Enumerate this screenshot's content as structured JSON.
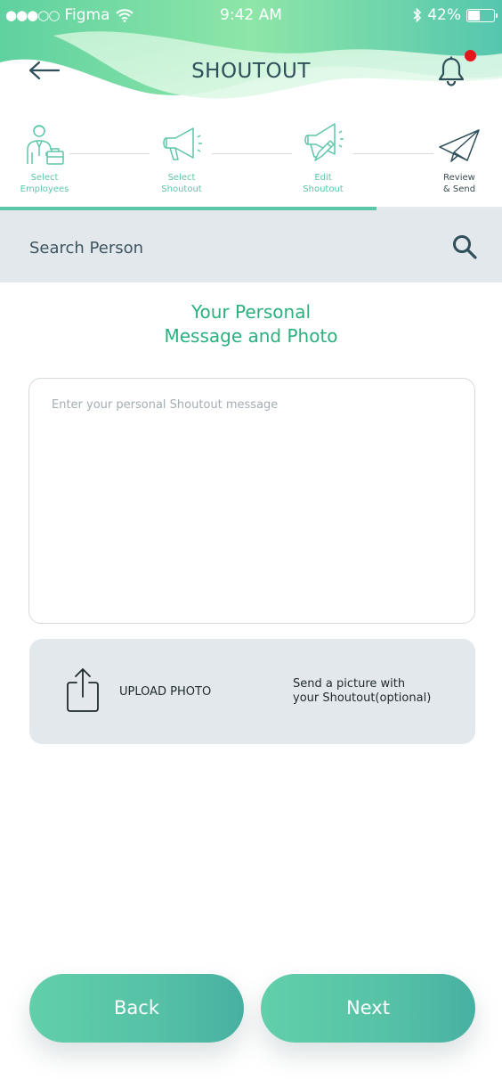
{
  "status_bar": {
    "signal": "●●●○○",
    "carrier": "Figma",
    "time": "9:42 AM",
    "battery": "42%",
    "battery_level": 0.42
  },
  "nav": {
    "title": "SHOUTOUT",
    "back_icon": "arrow-left-icon",
    "notification_icon": "bell-icon",
    "has_notification": true
  },
  "steps": [
    {
      "line1": "Select",
      "line2": "Employees",
      "icon": "employee-icon"
    },
    {
      "line1": "Select",
      "line2": "Shoutout",
      "icon": "megaphone-icon"
    },
    {
      "line1": "Edit",
      "line2": "Shoutout",
      "icon": "megaphone-edit-icon"
    },
    {
      "line1": "Review",
      "line2": "& Send",
      "icon": "paper-plane-icon"
    }
  ],
  "progress": {
    "completed_steps": 3,
    "total_steps": 4
  },
  "search": {
    "placeholder": "Search Person"
  },
  "heading": {
    "line1": "Your Personal",
    "line2": "Message and Photo"
  },
  "message": {
    "placeholder": "Enter your personal Shoutout message",
    "value": ""
  },
  "upload": {
    "label": "UPLOAD PHOTO",
    "hint_line1": "Send a picture with",
    "hint_line2": "your Shoutout(optional)",
    "icon": "share-upload-icon"
  },
  "buttons": {
    "back": "Back",
    "next": "Next"
  },
  "colors": {
    "accent": "#5cc6a8",
    "heading": "#2bb07e",
    "title": "#2f4f5b",
    "notification_dot": "#e8141c",
    "panel": "#e3e8ec"
  }
}
